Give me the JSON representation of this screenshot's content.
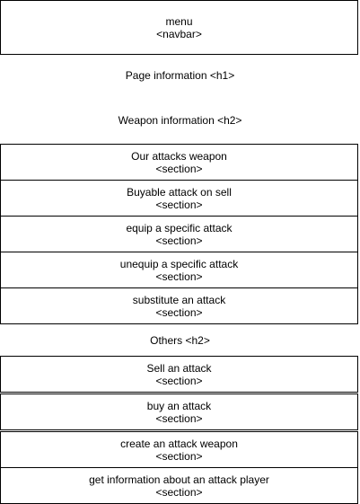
{
  "navbar": {
    "title": "menu",
    "tag": "<navbar>"
  },
  "page_heading": "Page information <h1>",
  "weapon_heading": "Weapon information <h2>",
  "weapon_sections": [
    {
      "title": "Our attacks weapon",
      "tag": "<section>"
    },
    {
      "title": "Buyable attack on sell",
      "tag": "<section>"
    },
    {
      "title": "equip a specific attack",
      "tag": "<section>"
    },
    {
      "title": "unequip a specific attack",
      "tag": "<section>"
    },
    {
      "title": "substitute an attack",
      "tag": "<section>"
    }
  ],
  "others_heading": "Others <h2>",
  "other_sections": [
    {
      "title": "Sell an attack",
      "tag": "<section>"
    },
    {
      "title": "buy an attack",
      "tag": "<section>"
    },
    {
      "title": "create an attack weapon",
      "tag": "<section>"
    },
    {
      "title": "get information about an attack player",
      "tag": "<section>"
    }
  ]
}
